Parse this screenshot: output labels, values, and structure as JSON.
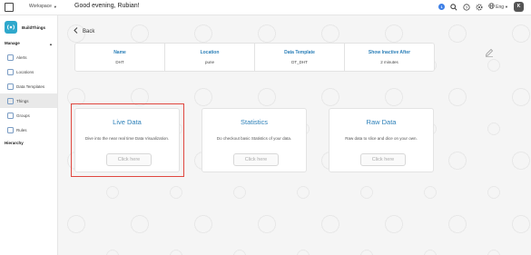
{
  "header": {
    "workspace_label": "Workspace",
    "greeting": "Good evening, Rubian!",
    "notification_count": "1",
    "language": "Eng",
    "avatar_initial": "K"
  },
  "sidebar": {
    "brand_name": "BuildThings",
    "section_manage": "Manage",
    "items": [
      {
        "label": "Alerts",
        "icon": "bell-icon"
      },
      {
        "label": "Locations",
        "icon": "location-icon"
      },
      {
        "label": "Data Templates",
        "icon": "template-icon"
      },
      {
        "label": "Things",
        "icon": "things-icon",
        "active": true
      },
      {
        "label": "Groups",
        "icon": "groups-icon"
      },
      {
        "label": "Rules",
        "icon": "rules-icon"
      }
    ],
    "section_hierarchy": "Hierarchy"
  },
  "main": {
    "back_label": "Back",
    "info": {
      "name_label": "Name",
      "name_value": "DHT",
      "location_label": "Location",
      "location_value": "pune",
      "template_label": "Data Template",
      "template_value": "DT_DHT",
      "inactive_label": "Show Inactive After",
      "inactive_value": "2 minutes"
    },
    "cards": [
      {
        "title": "Live Data",
        "desc": "Dive into the near real time Data Visualization.",
        "button": "Click here",
        "highlighted": true
      },
      {
        "title": "Statistics",
        "desc": "Do checkout basic Statistics of your data.",
        "button": "Click here"
      },
      {
        "title": "Raw Data",
        "desc": "Raw data to slice and dice on your own.",
        "button": "Click here"
      }
    ]
  },
  "colors": {
    "accent": "#2b7fb8",
    "brand": "#2fa8cc",
    "highlight": "#e0473f",
    "notification": "#3d7fe6"
  }
}
